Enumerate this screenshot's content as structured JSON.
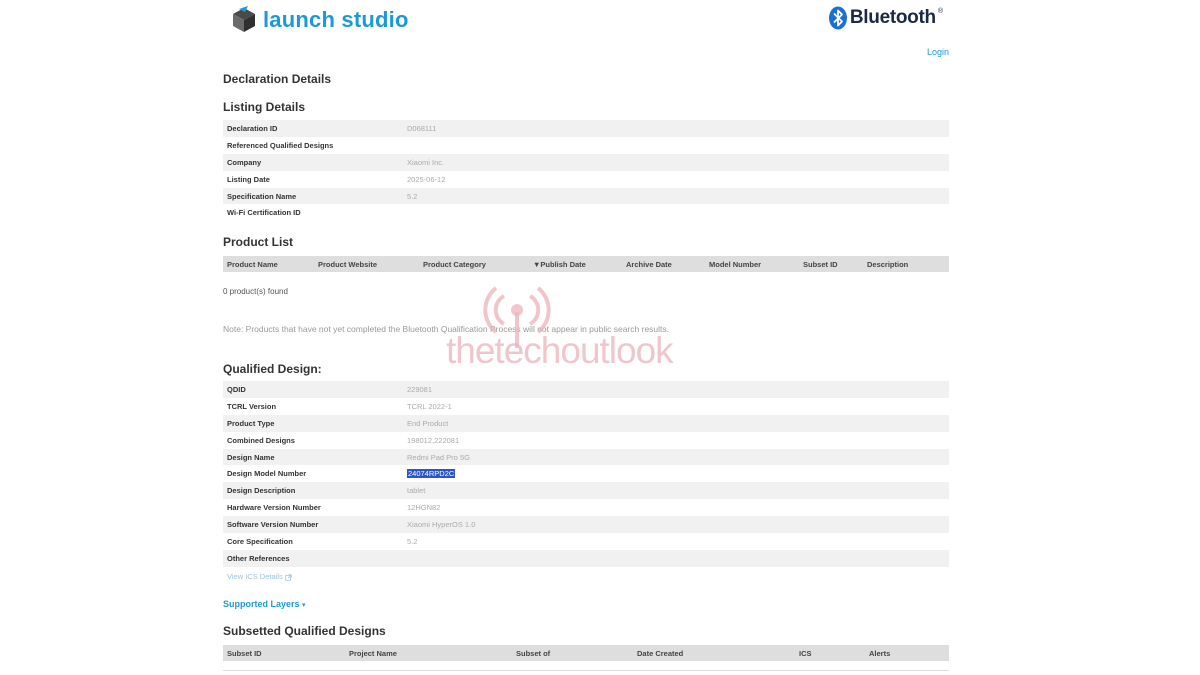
{
  "header": {
    "logo_text": "launch studio",
    "bluetooth_text": "Bluetooth",
    "bluetooth_trademark": "®",
    "login": "Login"
  },
  "page_title": "Declaration Details",
  "listing": {
    "title": "Listing Details",
    "rows": [
      {
        "label": "Declaration ID",
        "value": "D068111"
      },
      {
        "label": "Referenced Qualified Designs",
        "value": ""
      },
      {
        "label": "Company",
        "value": "Xiaomi Inc."
      },
      {
        "label": "Listing Date",
        "value": "2025-06-12"
      },
      {
        "label": "Specification Name",
        "value": "5.2"
      },
      {
        "label": "Wi-Fi Certification ID",
        "value": ""
      }
    ]
  },
  "product_list": {
    "title": "Product List",
    "columns": [
      "Product Name",
      "Product Website",
      "Product Category",
      "▼Publish Date",
      "Archive Date",
      "Model Number",
      "Subset ID",
      "Description"
    ],
    "found_text": "0 product(s) found",
    "note": "Note: Products that have not yet completed the Bluetooth Qualification Process will not appear in public search results."
  },
  "qualified_design": {
    "title": "Qualified Design:",
    "rows": [
      {
        "label": "QDID",
        "value": "229081"
      },
      {
        "label": "TCRL Version",
        "value": "TCRL 2022-1"
      },
      {
        "label": "Product Type",
        "value": "End Product"
      },
      {
        "label": "Combined Designs",
        "value": "198012,222081"
      },
      {
        "label": "Design Name",
        "value": "Redmi Pad Pro 5G"
      },
      {
        "label": "Design Model Number",
        "value": "24074RPD2C",
        "highlight": true
      },
      {
        "label": "Design Description",
        "value": "tablet"
      },
      {
        "label": "Hardware Version Number",
        "value": "12HGN82"
      },
      {
        "label": "Software Version Number",
        "value": "Xiaomi HyperOS 1.0"
      },
      {
        "label": "Core Specification",
        "value": "5.2"
      },
      {
        "label": "Other References",
        "value": ""
      }
    ],
    "ics_link": "View ICS Details"
  },
  "supported_layers": "Supported Layers",
  "subsetted": {
    "title": "Subsetted Qualified Designs",
    "columns": [
      "Subset ID",
      "Project Name",
      "Subset of",
      "Date Created",
      "ICS",
      "Alerts"
    ]
  },
  "watermark": "thetechoutlook",
  "colors": {
    "accent": "#1c9ad6",
    "highlight": "#2b55c9",
    "row_stripe": "#f1f1f1",
    "grid_header": "#dedede"
  }
}
